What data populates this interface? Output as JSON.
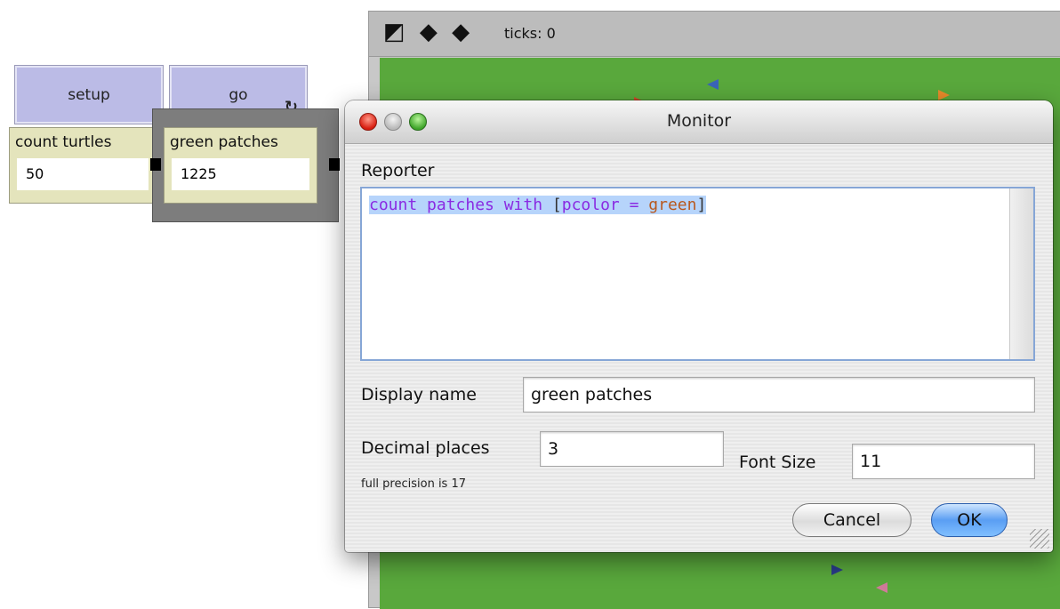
{
  "interface": {
    "setup_button": "setup",
    "go_button": "go",
    "monitors": [
      {
        "label": "count turtles",
        "value": "50"
      },
      {
        "label": "green patches",
        "value": "1225"
      }
    ]
  },
  "view": {
    "ticks": "ticks: 0",
    "tool_icons": "◩ ◆ ◆",
    "world_color": "#59a83c"
  },
  "dialog": {
    "title": "Monitor",
    "reporter_label": "Reporter",
    "reporter_code": {
      "keyword": "count patches with ",
      "open_bracket": "[",
      "expression": "pcolor = ",
      "color_word": "green",
      "close_bracket": "]"
    },
    "display_name_label": "Display name",
    "display_name_value": "green patches",
    "decimal_places_label": "Decimal places",
    "decimal_places_value": "3",
    "precision_note": "full precision is 17",
    "font_size_label": "Font Size",
    "font_size_value": "11",
    "cancel": "Cancel",
    "ok": "OK"
  }
}
